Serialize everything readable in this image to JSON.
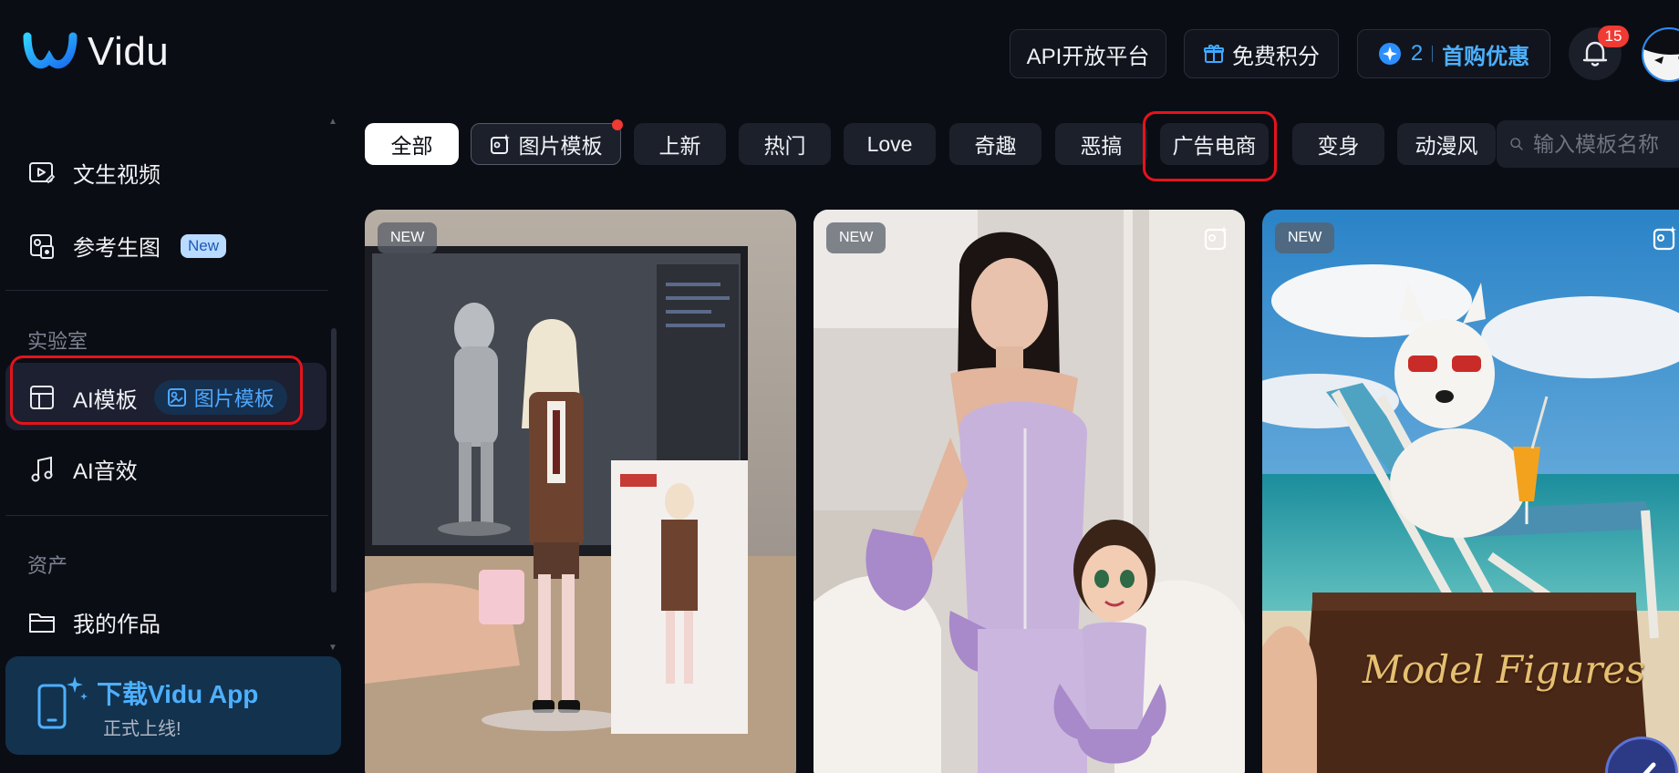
{
  "brand": {
    "name": "Vidu",
    "accent": "#1e90ff"
  },
  "header": {
    "api_label": "API开放平台",
    "free_points_label": "免费积分",
    "credits_count": "2",
    "first_purchase_label": "首购优惠",
    "notification_count": "15"
  },
  "sidebar": {
    "items": [
      {
        "label": "文生视频",
        "icon": "video-play-icon"
      },
      {
        "label": "参考生图",
        "icon": "reference-image-icon",
        "badge": "New"
      }
    ],
    "lab_section": "实验室",
    "lab_items": [
      {
        "label": "AI模板",
        "icon": "template-icon",
        "sub_label": "图片模板"
      },
      {
        "label": "AI音效",
        "icon": "music-note-icon"
      }
    ],
    "assets_section": "资产",
    "asset_items": [
      {
        "label": "我的作品",
        "icon": "folder-icon"
      }
    ],
    "download": {
      "title": "下载Vidu App",
      "subtitle": "正式上线!"
    }
  },
  "tabs": [
    {
      "label": "全部",
      "active": true
    },
    {
      "label": "图片模板",
      "icon": "image-sparkle-icon",
      "dot": true
    },
    {
      "label": "上新"
    },
    {
      "label": "热门"
    },
    {
      "label": "Love"
    },
    {
      "label": "奇趣"
    },
    {
      "label": "恶搞"
    },
    {
      "label": "广告电商",
      "highlighted": true
    },
    {
      "label": "变身"
    },
    {
      "label": "动漫风"
    }
  ],
  "search": {
    "placeholder": "输入模板名称"
  },
  "cards": [
    {
      "tag": "NEW",
      "subject": "figure-on-desk"
    },
    {
      "tag": "NEW",
      "subject": "lavender-corset-and-cartoon"
    },
    {
      "tag": "NEW",
      "subject": "dog-on-beach-chair",
      "caption": "Model Figures"
    }
  ]
}
